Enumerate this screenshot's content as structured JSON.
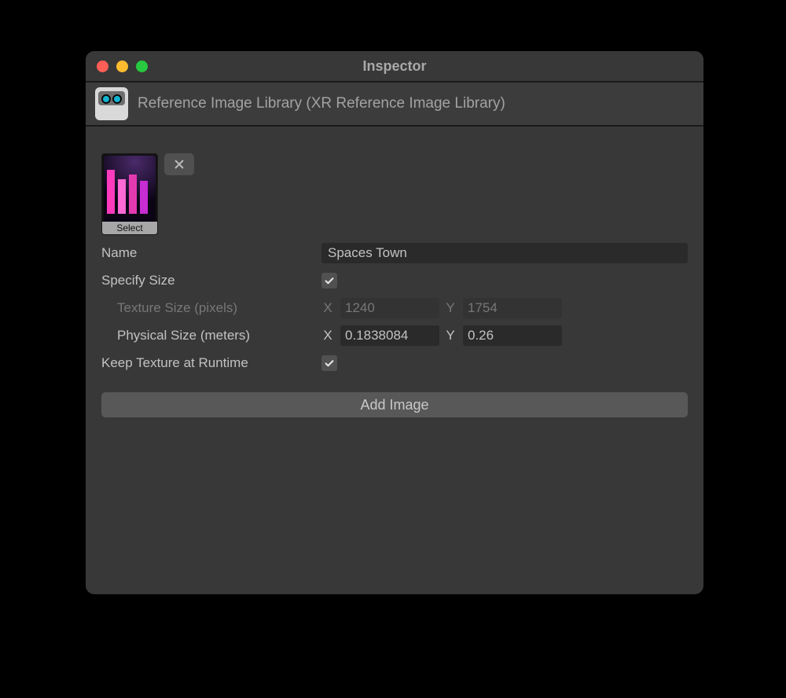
{
  "window": {
    "title": "Inspector"
  },
  "header": {
    "title": "Reference Image Library (XR Reference Image Library)"
  },
  "entry": {
    "thumbnail_select_label": "Select",
    "fields": {
      "name_label": "Name",
      "name_value": "Spaces Town",
      "specify_size_label": "Specify Size",
      "specify_size_checked": true,
      "texture_size_label": "Texture Size (pixels)",
      "texture_size_x_label": "X",
      "texture_size_x_value": "1240",
      "texture_size_y_label": "Y",
      "texture_size_y_value": "1754",
      "physical_size_label": "Physical Size (meters)",
      "physical_size_x_label": "X",
      "physical_size_x_value": "0.1838084",
      "physical_size_y_label": "Y",
      "physical_size_y_value": "0.26",
      "keep_texture_label": "Keep Texture at Runtime",
      "keep_texture_checked": true
    }
  },
  "buttons": {
    "add_image_label": "Add Image"
  }
}
